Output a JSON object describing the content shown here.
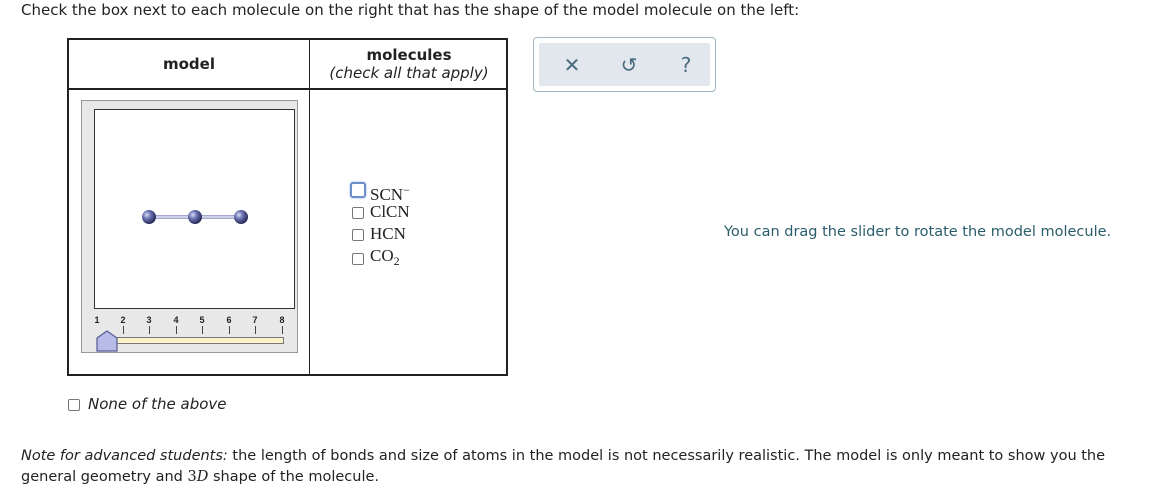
{
  "instruction": "Check the box next to each molecule on the right that has the shape of the model molecule on the left:",
  "table": {
    "model_header": "model",
    "molecules_header": "molecules",
    "molecules_subheader": "(check all that apply)"
  },
  "slider": {
    "ticks": [
      "1",
      "2",
      "3",
      "4",
      "5",
      "6",
      "7",
      "8"
    ],
    "value": 1
  },
  "options": [
    {
      "base": "SCN",
      "sub": "",
      "sup": "−",
      "checked": false
    },
    {
      "base": "ClCN",
      "sub": "",
      "sup": "",
      "checked": false
    },
    {
      "base": "HCN",
      "sub": "",
      "sup": "",
      "checked": false
    },
    {
      "base": "CO",
      "sub": "2",
      "sup": "",
      "checked": false
    }
  ],
  "none_option": {
    "label": "None of the above",
    "checked": false
  },
  "toolbar": {
    "close_glyph": "✕",
    "undo_glyph": "↺",
    "help_glyph": "?"
  },
  "hint": "You can drag the slider to rotate the model molecule.",
  "note": {
    "lead": "Note for advanced students:",
    "text_1": " the length of bonds and size of atoms in the model is not necessarily realistic. The model is only meant to show you the general geometry and ",
    "math_num": "3",
    "math_var": "D",
    "text_2": " shape of the molecule."
  },
  "colors": {
    "atom": "#5a5f9e",
    "hint_text": "#2a5d6c",
    "toolbar_bg": "#e1e7ec"
  }
}
